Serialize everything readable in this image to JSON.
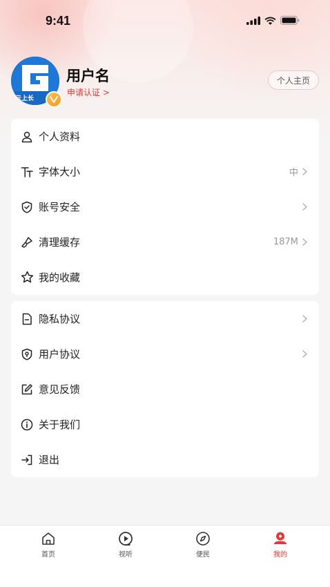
{
  "status": {
    "time": "9:41"
  },
  "profile": {
    "avatar_text": "云上长",
    "username": "用户名",
    "apply_verify": "申请认证 >",
    "homepage_button": "个人主页"
  },
  "menu_group1": [
    {
      "label": "个人资料",
      "value": "",
      "icon": "user-icon"
    },
    {
      "label": "字体大小",
      "value": "中",
      "icon": "font-size-icon"
    },
    {
      "label": "账号安全",
      "value": "",
      "icon": "shield-check-icon"
    },
    {
      "label": "清理缓存",
      "value": "187M",
      "icon": "brush-icon"
    },
    {
      "label": "我的收藏",
      "value": "",
      "icon": "star-icon"
    }
  ],
  "menu_group2": [
    {
      "label": "隐私协议",
      "value": "",
      "icon": "document-icon"
    },
    {
      "label": "用户协议",
      "value": "",
      "icon": "shield-location-icon"
    },
    {
      "label": "意见反馈",
      "value": "",
      "icon": "edit-icon"
    },
    {
      "label": "关于我们",
      "value": "",
      "icon": "info-icon"
    },
    {
      "label": "退出",
      "value": "",
      "icon": "logout-icon"
    }
  ],
  "tabbar": [
    {
      "label": "首页",
      "icon": "home-icon",
      "active": false
    },
    {
      "label": "视听",
      "icon": "play-icon",
      "active": false
    },
    {
      "label": "便民",
      "icon": "compass-icon",
      "active": false
    },
    {
      "label": "我的",
      "icon": "person-icon",
      "active": true
    }
  ],
  "colors": {
    "accent": "#e53935",
    "avatar_bg": "#1e78d8",
    "badge": "#f5a623"
  }
}
